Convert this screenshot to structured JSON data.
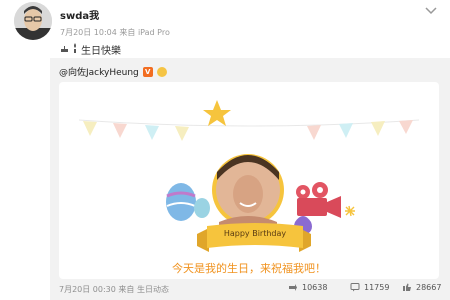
{
  "post": {
    "author": "swda我",
    "meta": "7月20日 10:04 来自 iPad Pro",
    "text": "生日快樂"
  },
  "repost": {
    "mention": "@向佐JackyHeung",
    "card": {
      "banner_text": "Happy Birthday",
      "message": "今天是我的生日，来祝福我吧！"
    },
    "footer": "7月20日 00:30 来自 生日动态",
    "stats": {
      "forward": "10638",
      "comment": "11759",
      "like": "28667"
    }
  },
  "colors": {
    "accent": "#f0921e",
    "banner": "#f6c43d",
    "verified": "#f26d21"
  },
  "icons": [
    "chevron-down-icon",
    "cake-icon",
    "candle-icon",
    "verified-badge-icon",
    "emoji-icon",
    "forward-icon",
    "comment-icon",
    "like-icon"
  ]
}
